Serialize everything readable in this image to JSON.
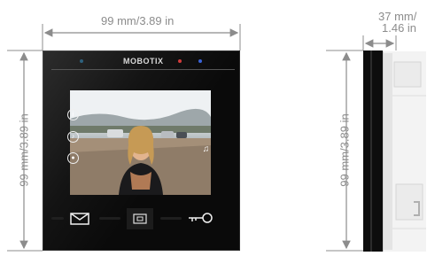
{
  "dimensions": {
    "width_label": "99 mm/3.89 in",
    "height_label_front": "99 mm/3.89 in",
    "height_label_side": "99 mm/3.89 in",
    "depth_label_line1": "37 mm/",
    "depth_label_line2": "1.46 in"
  },
  "device": {
    "brand": "MOBOTIX",
    "leds": [
      "#3aa0d8",
      "#d23b3b",
      "#3a63d8"
    ],
    "screen_side_icons": [
      "info-icon",
      "bell-icon",
      "person-icon"
    ],
    "screen_right_icon": "music-note-icon",
    "buttons": [
      "envelope-icon",
      "camera-icon",
      "key-icon"
    ]
  },
  "colors": {
    "dimension_line": "#8c8c8c",
    "device_body": "#0a0a0a"
  }
}
